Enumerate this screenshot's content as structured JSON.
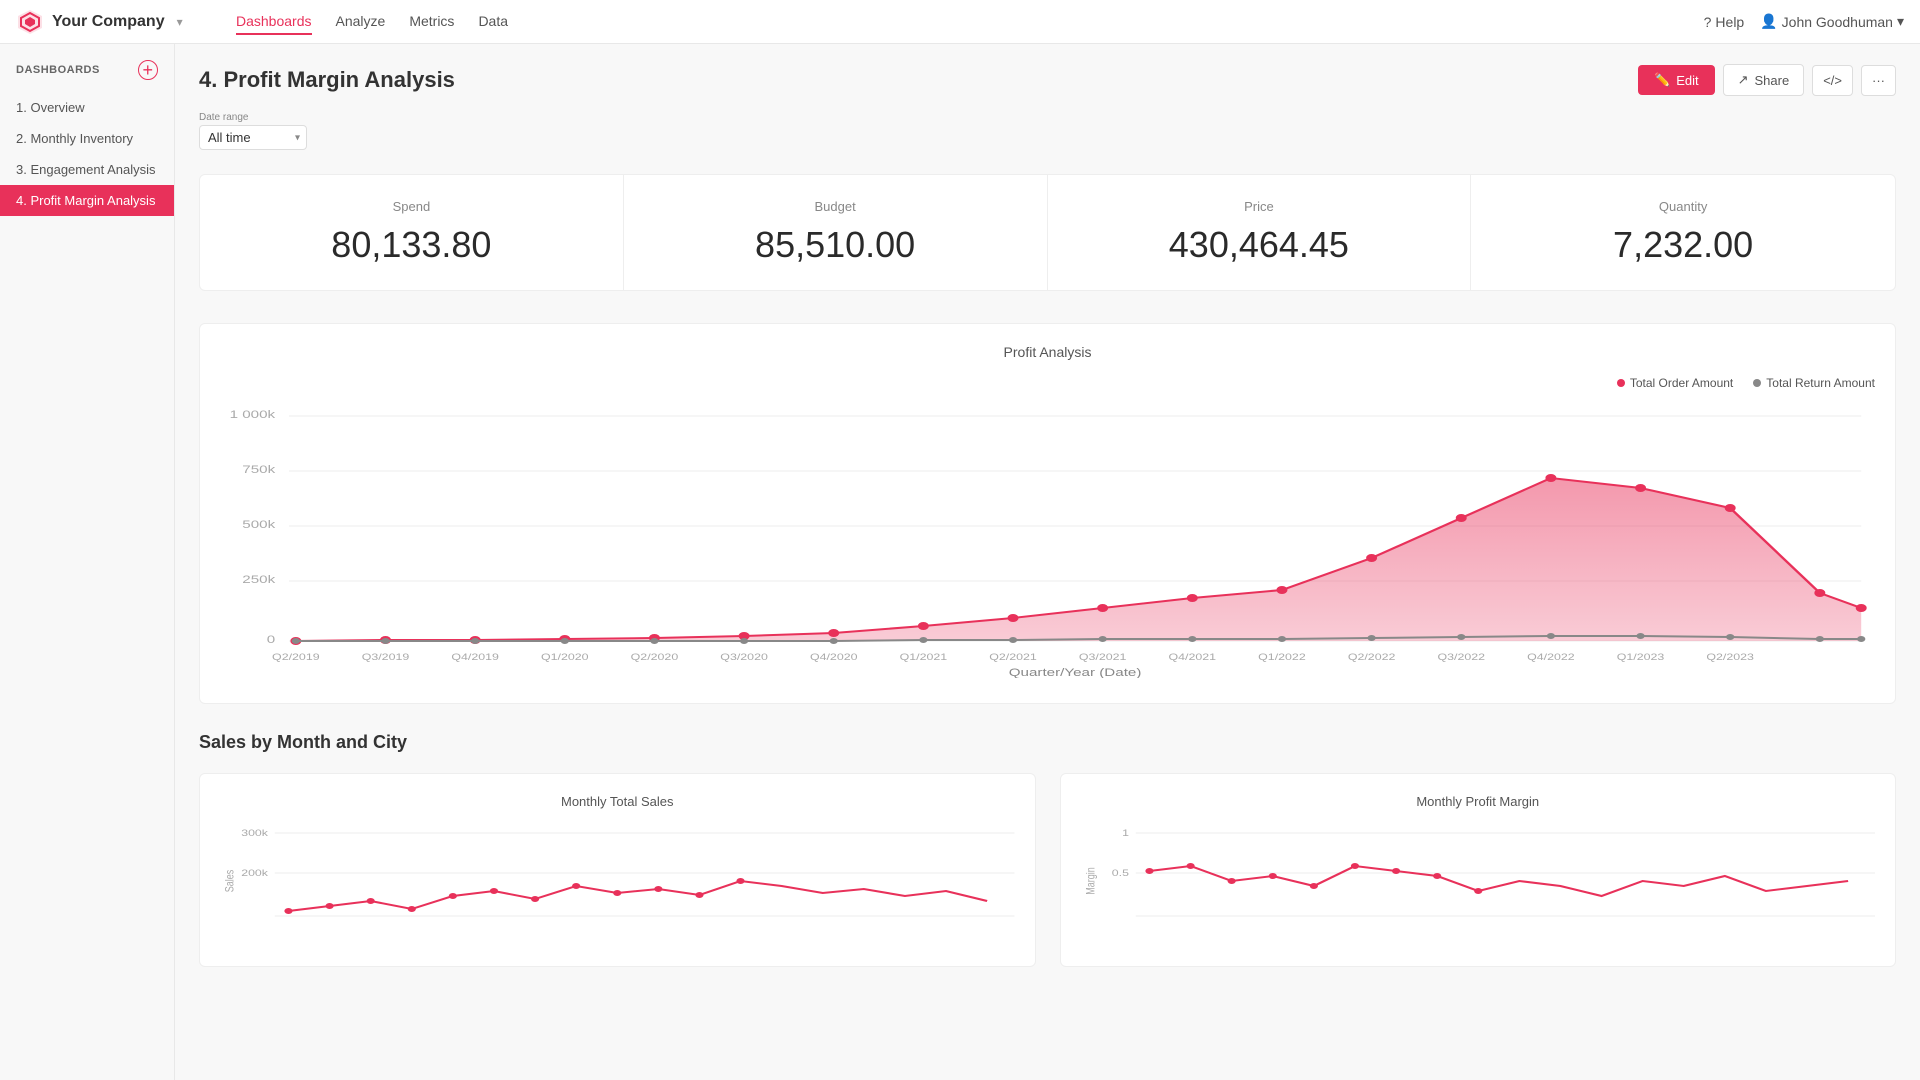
{
  "app": {
    "company": "Your Company",
    "logo_alt": "company-logo"
  },
  "topnav": {
    "links": [
      {
        "label": "Dashboards",
        "active": true
      },
      {
        "label": "Analyze",
        "active": false
      },
      {
        "label": "Metrics",
        "active": false
      },
      {
        "label": "Data",
        "active": false
      }
    ],
    "help": "Help",
    "user": "John Goodhuman",
    "chevron": "▾"
  },
  "sidebar": {
    "header": "DASHBOARDS",
    "add_label": "+",
    "items": [
      {
        "label": "1. Overview",
        "active": false
      },
      {
        "label": "2. Monthly Inventory",
        "active": false
      },
      {
        "label": "3. Engagement Analysis",
        "active": false
      },
      {
        "label": "4. Profit Margin Analysis",
        "active": true
      }
    ]
  },
  "page": {
    "title": "4. Profit Margin Analysis",
    "edit_label": "Edit",
    "share_label": "Share",
    "code_label": "</>",
    "more_label": "···"
  },
  "date_filter": {
    "label": "Date range",
    "value": "All time"
  },
  "kpis": [
    {
      "label": "Spend",
      "value": "80,133.80"
    },
    {
      "label": "Budget",
      "value": "85,510.00"
    },
    {
      "label": "Price",
      "value": "430,464.45"
    },
    {
      "label": "Quantity",
      "value": "7,232.00"
    }
  ],
  "profit_chart": {
    "title": "Profit Analysis",
    "legend": [
      {
        "label": "Total Order Amount",
        "color": "#e8315a"
      },
      {
        "label": "Total Return Amount",
        "color": "#888"
      }
    ],
    "x_axis_label": "Quarter/Year (Date)",
    "y_labels": [
      "0",
      "250k",
      "500k",
      "750k",
      "1 000k"
    ],
    "x_labels": [
      "Q2/2019",
      "Q3/2019",
      "Q4/2019",
      "Q1/2020",
      "Q2/2020",
      "Q3/2020",
      "Q4/2020",
      "Q1/2021",
      "Q2/2021",
      "Q3/2021",
      "Q4/2021",
      "Q1/2022",
      "Q2/2022",
      "Q3/2022",
      "Q4/2022",
      "Q1/2023",
      "Q2/2023"
    ]
  },
  "sales_section": {
    "title": "Sales by Month and City",
    "monthly_total_title": "Monthly Total Sales",
    "monthly_margin_title": "Monthly Profit Margin",
    "total_y_labels": [
      "300k",
      "200k"
    ],
    "margin_y_labels": [
      "1",
      "0.5"
    ],
    "x_axis_sales": "Sales",
    "x_axis_margin": "Margin"
  }
}
